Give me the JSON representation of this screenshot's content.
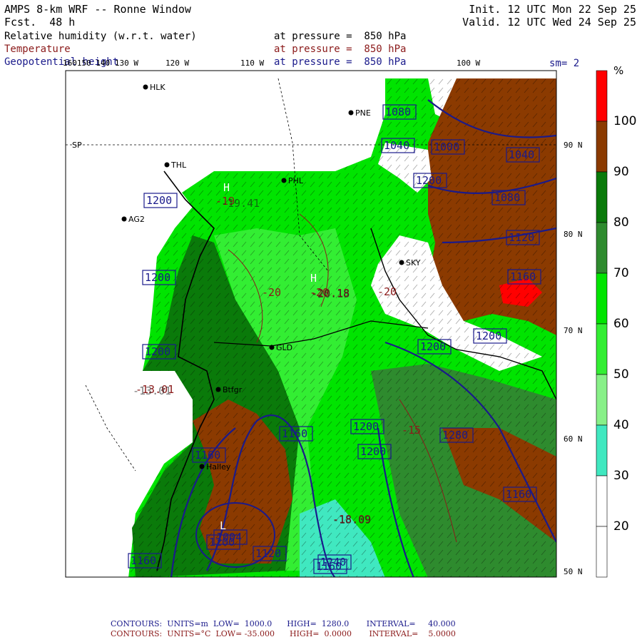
{
  "header": {
    "model": "AMPS 8-km WRF -- Ronne Window",
    "init": "Init. 12 UTC Mon 22 Sep 25",
    "forecast": "Fcst.  48 h",
    "valid": "Valid. 12 UTC Wed 24 Sep 25",
    "field1": "Relative humidity (w.r.t. water)",
    "field2": "Temperature",
    "field3": "Geopotential height",
    "pressure1": "at pressure =  850 hPa",
    "pressure2": "at pressure =  850 hPa",
    "pressure3": "at pressure =  850 hPa",
    "smoothing": "sm= 2"
  },
  "colors": {
    "rh_90_100": "#8b3a00",
    "rh_80_90": "#0a7a0a",
    "rh_70_80": "#2e8b2e",
    "rh_60_70": "#00e400",
    "rh_50_60": "#33ee33",
    "rh_40_50": "#88f088",
    "rh_30_40": "#40e8c0",
    "rh_20_30": "#ffffff",
    "rh_100": "#ff0000",
    "temperature": "#8b1a1a",
    "height": "#1a1a8b"
  },
  "colorbar": {
    "unit": "%",
    "labels": [
      "100",
      "90",
      "80",
      "70",
      "60",
      "50",
      "40",
      "30",
      "20"
    ]
  },
  "lon_labels": [
    "160W",
    "150W",
    "140W",
    "130W",
    "120 W",
    "110 W",
    "100 W"
  ],
  "lon_label_stack": "160150 140 130 W",
  "lat_labels": [
    "90 N",
    "80 N",
    "70 N",
    "60 N",
    "50 N"
  ],
  "stations": [
    {
      "name": "HLK"
    },
    {
      "name": "THL"
    },
    {
      "name": "AG2"
    },
    {
      "name": "PHL"
    },
    {
      "name": "PNE"
    },
    {
      "name": "SKY"
    },
    {
      "name": "GLD"
    },
    {
      "name": "Btfgr"
    },
    {
      "name": "Halley"
    },
    {
      "name": "SP"
    }
  ],
  "height_labels": [
    "1080",
    "1040",
    "1000",
    "1040",
    "1080",
    "1120",
    "1160",
    "1160",
    "1200",
    "1200",
    "1200",
    "1200",
    "1200",
    "1200",
    "1200",
    "1200",
    "1160",
    "1120",
    "1160",
    "1240",
    "1280",
    "1160",
    "1160",
    "1200",
    "1004"
  ],
  "temp_labels": [
    "-20",
    "-20",
    "-20",
    "-19",
    "-15",
    "-20.18",
    "-18.09",
    "-13.01"
  ],
  "high_low_marks": [
    "H",
    "H",
    "L",
    "L"
  ],
  "center_values": [
    "-19.41",
    "-13.01",
    "-18.09",
    "-20.18"
  ],
  "footer": {
    "line1": "CONTOURS:  UNITS=m  LOW=  1000.0      HIGH=  1280.0       INTERVAL=     40.000",
    "line2": "CONTOURS:  UNITS=°C  LOW= -35.000      HIGH=  0.0000       INTERVAL=    5.0000"
  }
}
